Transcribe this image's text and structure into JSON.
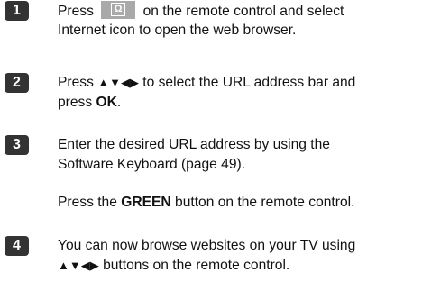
{
  "steps": [
    {
      "number": "1",
      "lines": {
        "l1_before": "Press",
        "l1_after": "on the remote control and select",
        "l2": "Internet icon to open the web browser."
      },
      "button_glyph": "Ω",
      "button_icon": "internet-apps-button"
    },
    {
      "number": "2",
      "lines": {
        "l1_before": "Press",
        "arrows": "▲▼◀▶",
        "l1_after": "to select the URL address bar and",
        "l2_before": "press",
        "l2_bold": "OK",
        "l2_after": "."
      }
    },
    {
      "number": "3",
      "lines": {
        "l1": "Enter the desired URL address by using the",
        "l2": "Software Keyboard (page 49).",
        "p2_before": "Press the",
        "p2_bold": "GREEN",
        "p2_after": "button on the remote control."
      }
    },
    {
      "number": "4",
      "lines": {
        "l1": "You can now browse websites on your TV using",
        "arrows": "▲▼◀▶",
        "l2_after": "buttons on the remote control."
      }
    }
  ]
}
